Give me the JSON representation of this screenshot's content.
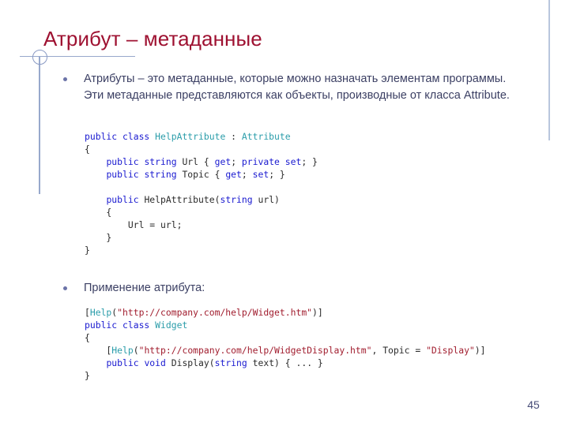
{
  "slide": {
    "title": "Атрибут – метаданные",
    "number": "45",
    "colors": {
      "title": "#9e1131",
      "body_text": "#3b3f63",
      "deco_line": "#97a8cc",
      "deco_line_right": "#b9c6dd",
      "bullet_dot": "#6b73a8",
      "code_keyword": "#1a1ad0",
      "code_type": "#2b9daa",
      "code_string": "#a11d2e",
      "code_plain": "#2a2a2a",
      "slide_number": "#474d78",
      "background": "#ffffff"
    }
  },
  "bullets": [
    {
      "id": "bullet-1",
      "text": "Атрибуты – это метаданные, которые можно назначать элементам программы. Эти метаданные представляются как объекты, производные от класса Attribute."
    },
    {
      "id": "bullet-2",
      "text": "Применение атрибута:"
    }
  ],
  "code_blocks": [
    {
      "id": "code-1",
      "lines": [
        [
          {
            "t": "public class ",
            "c": "kw"
          },
          {
            "t": "HelpAttribute",
            "c": "typ"
          },
          {
            "t": " : ",
            "c": "pln"
          },
          {
            "t": "Attribute",
            "c": "typ"
          }
        ],
        [
          {
            "t": "{",
            "c": "pln"
          }
        ],
        [
          {
            "t": "    ",
            "c": "pln"
          },
          {
            "t": "public string ",
            "c": "kw"
          },
          {
            "t": "Url { ",
            "c": "pln"
          },
          {
            "t": "get",
            "c": "kw"
          },
          {
            "t": "; ",
            "c": "pln"
          },
          {
            "t": "private set",
            "c": "kw"
          },
          {
            "t": "; }",
            "c": "pln"
          }
        ],
        [
          {
            "t": "    ",
            "c": "pln"
          },
          {
            "t": "public string ",
            "c": "kw"
          },
          {
            "t": "Topic { ",
            "c": "pln"
          },
          {
            "t": "get",
            "c": "kw"
          },
          {
            "t": "; ",
            "c": "pln"
          },
          {
            "t": "set",
            "c": "kw"
          },
          {
            "t": "; }",
            "c": "pln"
          }
        ],
        [
          {
            "t": "",
            "c": "pln"
          }
        ],
        [
          {
            "t": "    ",
            "c": "pln"
          },
          {
            "t": "public ",
            "c": "kw"
          },
          {
            "t": "HelpAttribute(",
            "c": "pln"
          },
          {
            "t": "string",
            "c": "kw"
          },
          {
            "t": " url)",
            "c": "pln"
          }
        ],
        [
          {
            "t": "    {",
            "c": "pln"
          }
        ],
        [
          {
            "t": "        Url = url;",
            "c": "pln"
          }
        ],
        [
          {
            "t": "    }",
            "c": "pln"
          }
        ],
        [
          {
            "t": "}",
            "c": "pln"
          }
        ]
      ]
    },
    {
      "id": "code-2",
      "lines": [
        [
          {
            "t": "[",
            "c": "pln"
          },
          {
            "t": "Help",
            "c": "typ"
          },
          {
            "t": "(",
            "c": "pln"
          },
          {
            "t": "\"http://company.com/help/Widget.htm\"",
            "c": "str"
          },
          {
            "t": ")]",
            "c": "pln"
          }
        ],
        [
          {
            "t": "public class ",
            "c": "kw"
          },
          {
            "t": "Widget",
            "c": "typ"
          }
        ],
        [
          {
            "t": "{",
            "c": "pln"
          }
        ],
        [
          {
            "t": "    [",
            "c": "pln"
          },
          {
            "t": "Help",
            "c": "typ"
          },
          {
            "t": "(",
            "c": "pln"
          },
          {
            "t": "\"http://company.com/help/WidgetDisplay.htm\"",
            "c": "str"
          },
          {
            "t": ", Topic = ",
            "c": "pln"
          },
          {
            "t": "\"Display\"",
            "c": "str"
          },
          {
            "t": ")]",
            "c": "pln"
          }
        ],
        [
          {
            "t": "    ",
            "c": "pln"
          },
          {
            "t": "public void ",
            "c": "kw"
          },
          {
            "t": "Display(",
            "c": "pln"
          },
          {
            "t": "string",
            "c": "kw"
          },
          {
            "t": " text) { ... }",
            "c": "pln"
          }
        ],
        [
          {
            "t": "}",
            "c": "pln"
          }
        ]
      ]
    }
  ]
}
